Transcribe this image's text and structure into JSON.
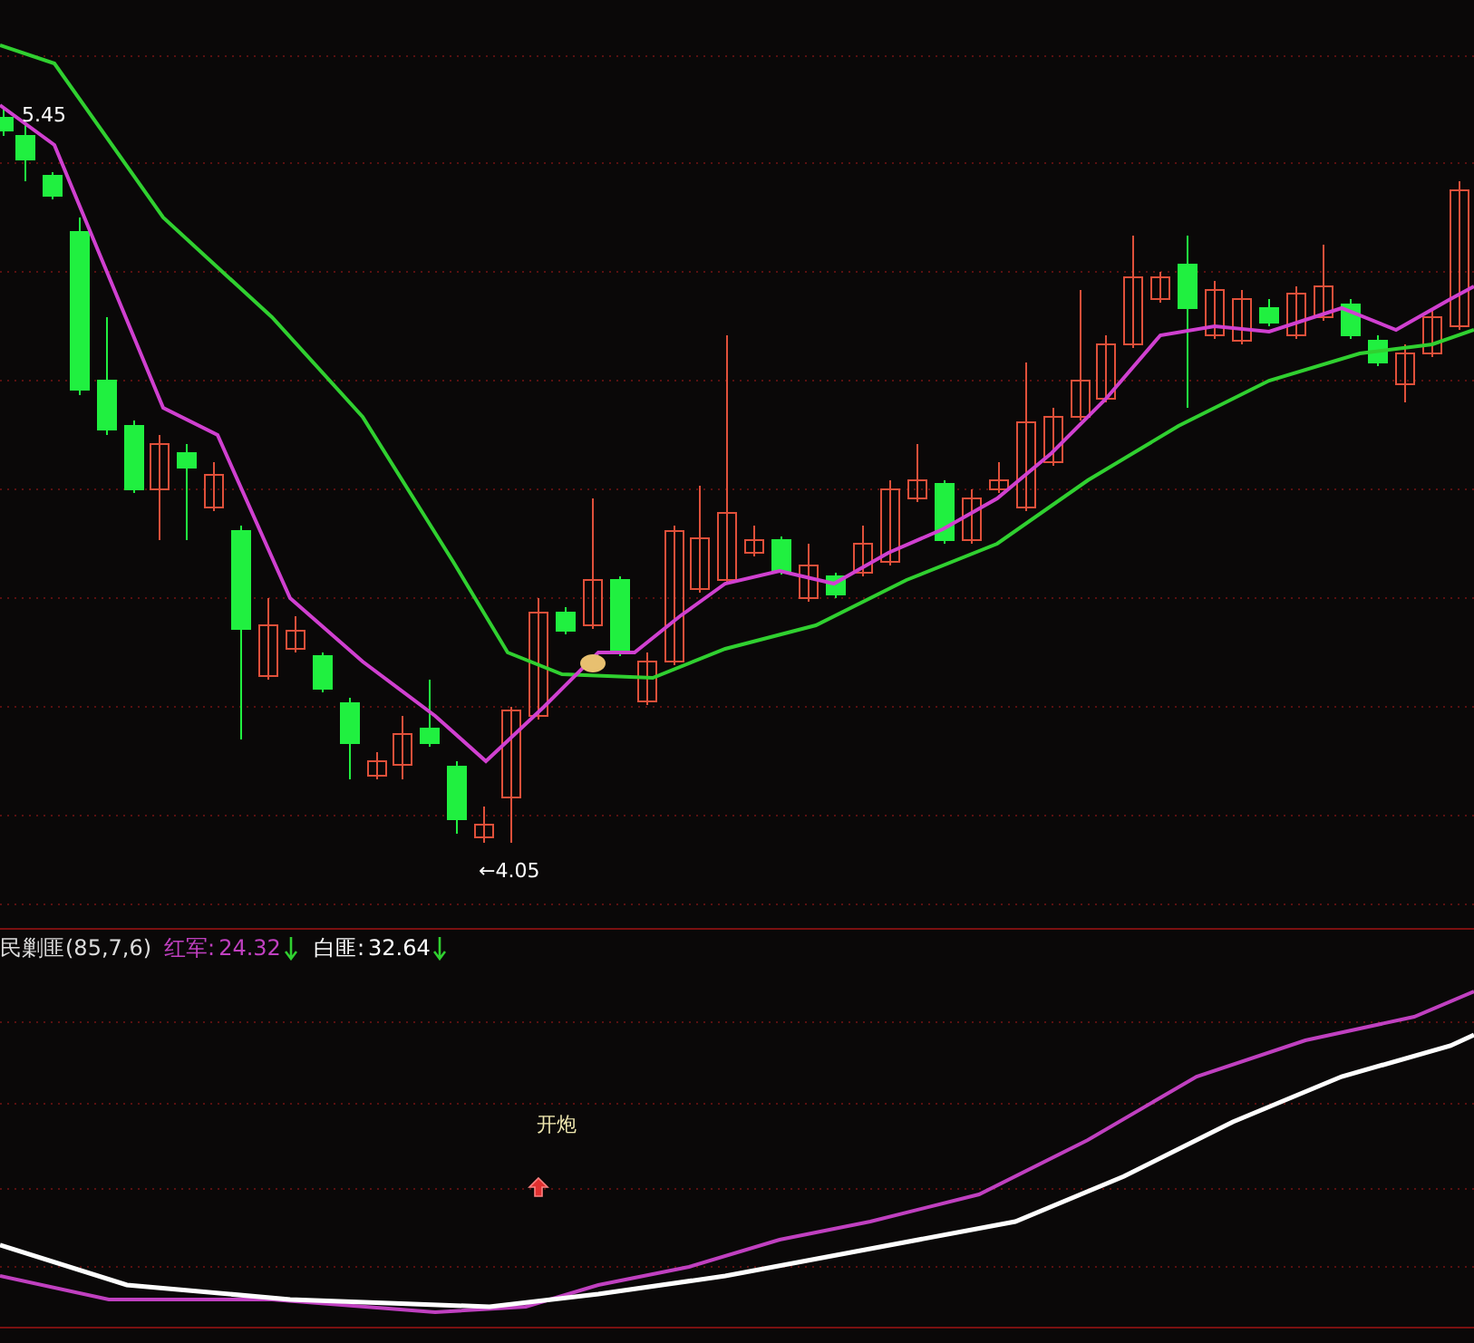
{
  "main_chart": {
    "high_label": "5.45",
    "low_label": "←4.05"
  },
  "indicator": {
    "name": "民剿匪(85,7,6)",
    "series": [
      {
        "name": "红军:",
        "value": "24.32",
        "color": "#c040c0"
      },
      {
        "name": "白匪:",
        "value": "32.64",
        "color": "#ffffff"
      }
    ],
    "signal": "开炮"
  }
}
